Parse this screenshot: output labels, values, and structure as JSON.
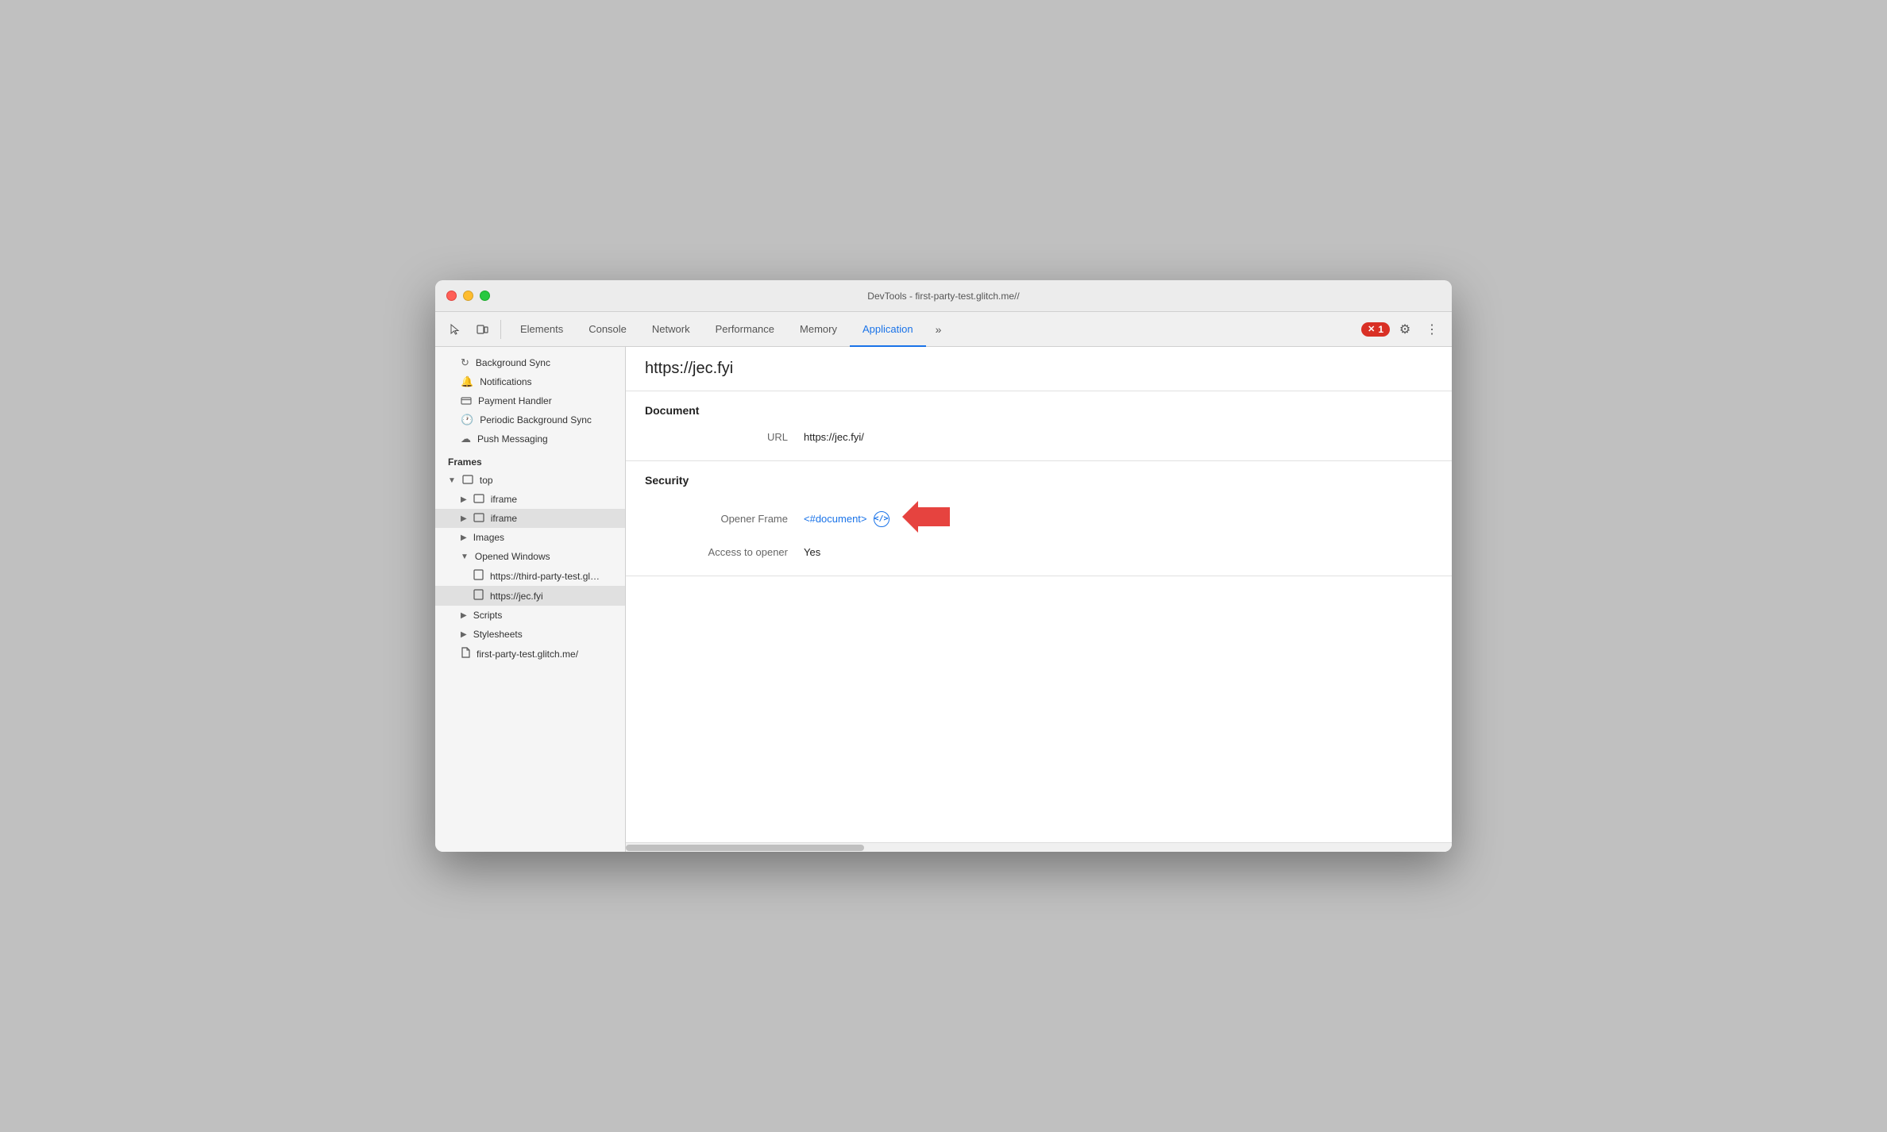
{
  "window": {
    "title": "DevTools - first-party-test.glitch.me//"
  },
  "toolbar": {
    "tabs": [
      {
        "id": "elements",
        "label": "Elements",
        "active": false
      },
      {
        "id": "console",
        "label": "Console",
        "active": false
      },
      {
        "id": "network",
        "label": "Network",
        "active": false
      },
      {
        "id": "performance",
        "label": "Performance",
        "active": false
      },
      {
        "id": "memory",
        "label": "Memory",
        "active": false
      },
      {
        "id": "application",
        "label": "Application",
        "active": true
      }
    ],
    "more_label": "»",
    "error_count": "1",
    "gear_icon": "⚙",
    "dots_icon": "⋮"
  },
  "sidebar": {
    "service_worker_items": [
      {
        "id": "background-sync",
        "icon": "↻",
        "label": "Background Sync",
        "indent": 1
      },
      {
        "id": "notifications",
        "icon": "🔔",
        "label": "Notifications",
        "indent": 1
      },
      {
        "id": "payment-handler",
        "icon": "💳",
        "label": "Payment Handler",
        "indent": 1
      },
      {
        "id": "periodic-bg-sync",
        "icon": "🕐",
        "label": "Periodic Background Sync",
        "indent": 1
      },
      {
        "id": "push-messaging",
        "icon": "☁",
        "label": "Push Messaging",
        "indent": 1
      }
    ],
    "frames_label": "Frames",
    "frames": {
      "top": {
        "label": "top",
        "expanded": true,
        "children": [
          {
            "id": "iframe1",
            "label": "iframe",
            "expanded": false
          },
          {
            "id": "iframe2",
            "label": "iframe",
            "expanded": false,
            "selected": true
          },
          {
            "id": "images",
            "label": "Images",
            "expanded": false
          },
          {
            "id": "opened-windows",
            "label": "Opened Windows",
            "expanded": true,
            "children": [
              {
                "id": "third-party-window",
                "label": "https://third-party-test.glitch.me/p"
              },
              {
                "id": "jec-fyi-window",
                "label": "https://jec.fyi",
                "selected": true
              }
            ]
          },
          {
            "id": "scripts",
            "label": "Scripts",
            "expanded": false
          },
          {
            "id": "stylesheets",
            "label": "Stylesheets",
            "expanded": false
          },
          {
            "id": "first-party-test",
            "label": "first-party-test.glitch.me/"
          }
        ]
      }
    }
  },
  "content": {
    "url": "https://jec.fyi",
    "document_section": {
      "title": "Document",
      "rows": [
        {
          "label": "URL",
          "value": "https://jec.fyi/",
          "type": "text"
        }
      ]
    },
    "security_section": {
      "title": "Security",
      "rows": [
        {
          "label": "Opener Frame",
          "value": "<#document>",
          "type": "link",
          "icon": "</>"
        },
        {
          "label": "Access to opener",
          "value": "Yes",
          "type": "text"
        }
      ]
    }
  }
}
